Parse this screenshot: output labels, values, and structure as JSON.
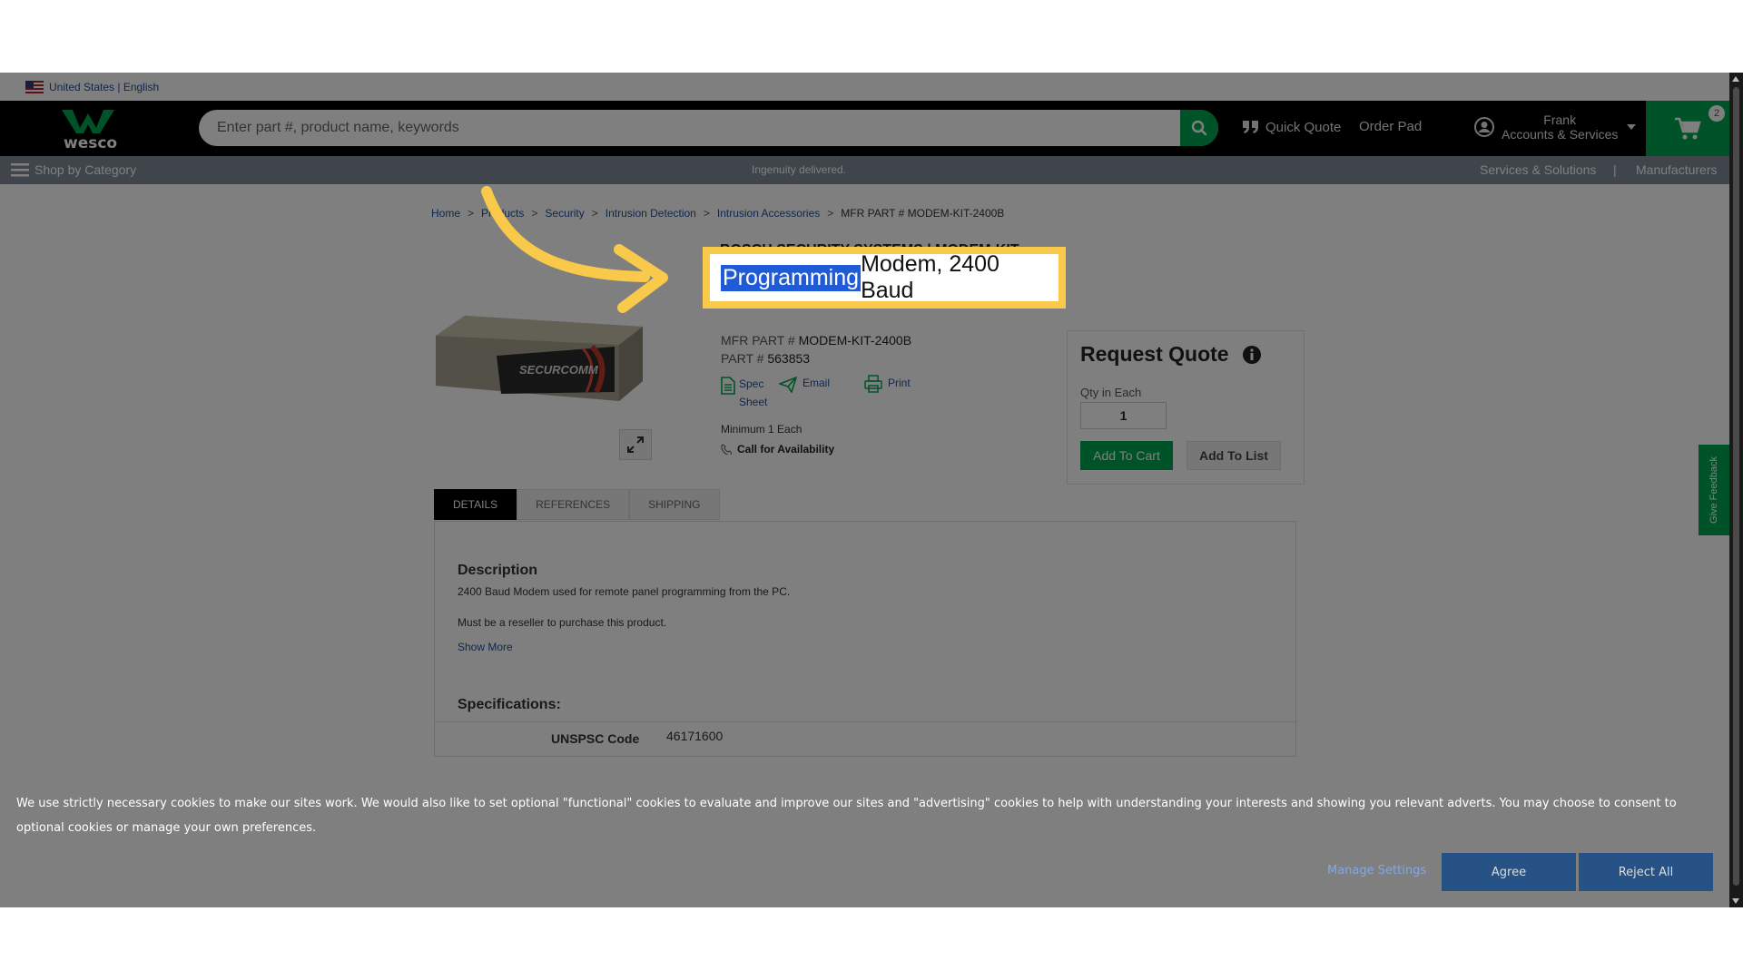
{
  "locale": {
    "label": "United States | English"
  },
  "header": {
    "logo_text": "wesco",
    "search_placeholder": "Enter part #, product name, keywords",
    "quick_quote": "Quick Quote",
    "order_pad": "Order Pad",
    "account_name": "Frank",
    "account_label": "Accounts & Services",
    "cart_count": "2"
  },
  "subnav": {
    "shop_by_category": "Shop by Category",
    "tagline": "Ingenuity delivered.",
    "services": "Services & Solutions",
    "separator": "|",
    "manufacturers": "Manufacturers"
  },
  "breadcrumb": {
    "items": [
      "Home",
      "Products",
      "Security",
      "Intrusion Detection",
      "Intrusion Accessories"
    ],
    "separator": ">",
    "current": "MFR PART # MODEM-KIT-2400B"
  },
  "product": {
    "brand_line": "BOSCH SECURITY SYSTEMS | MODEM-KIT-2400B",
    "title_highlight": "Programming",
    "title_rest": " Modem, 2400 Baud",
    "image_label": "SECURCOMM",
    "mfr_part_label": "MFR PART #",
    "mfr_part_value": "MODEM-KIT-2400B",
    "part_label": "PART #",
    "part_value": "563853",
    "spec_sheet": "Spec Sheet",
    "email": "Email",
    "print": "Print",
    "minimum": "Minimum 1 Each",
    "availability": "Call for Availability"
  },
  "quote": {
    "title": "Request Quote",
    "qty_label": "Qty in Each",
    "qty_value": "1",
    "add_to_cart": "Add To Cart",
    "add_to_list": "Add To List"
  },
  "tabs": [
    "DETAILS",
    "REFERENCES",
    "SHIPPING"
  ],
  "details": {
    "description_heading": "Description",
    "description_1": "2400 Baud Modem used for remote panel programming from the PC.",
    "description_2": "Must be a reseller to purchase this product.",
    "show_more": "Show More",
    "specifications_heading": "Specifications:",
    "spec_key": "UNSPSC Code",
    "spec_value": "46171600"
  },
  "feedback": "Give Feedback",
  "cookie": {
    "text": "We use strictly necessary cookies to make our sites work. We would also like to set optional \"functional\" cookies to evaluate and improve our sites and \"advertising\" cookies to help with understanding your interests and showing you relevant adverts. You may choose to consent to optional cookies or manage your own preferences.",
    "manage_settings": "Manage Settings",
    "agree": "Agree",
    "reject_all": "Reject All"
  },
  "colors": {
    "brand_green": "#00a651",
    "header_bg": "#000000",
    "highlight_frame": "#f8c94a",
    "selection_blue": "#1f5bd6",
    "link_blue": "#1f4e9c"
  }
}
